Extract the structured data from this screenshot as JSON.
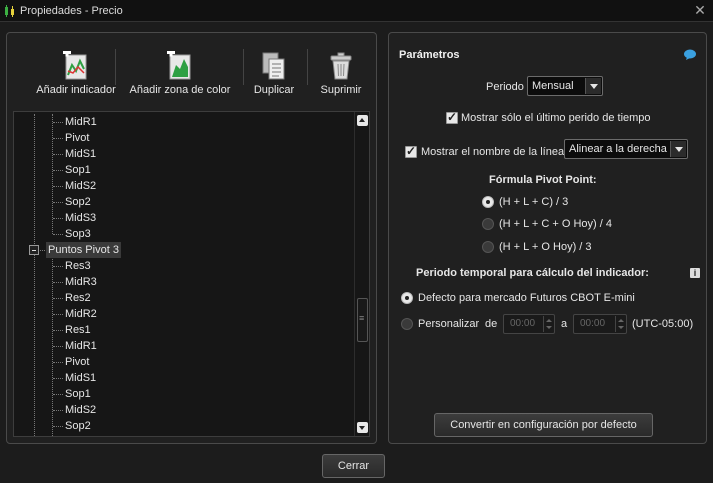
{
  "window": {
    "title": "Propiedades - Precio"
  },
  "toolbar": {
    "add_indicator": "Añadir indicador",
    "add_color_zone": "Añadir zona de color",
    "duplicate": "Duplicar",
    "delete": "Suprimir"
  },
  "tree": {
    "rows_before": [
      "MidR1",
      "Pivot",
      "MidS1",
      "Sop1",
      "MidS2",
      "Sop2",
      "MidS3",
      "Sop3"
    ],
    "group": "Puntos Pivot 3",
    "rows_after": [
      "Res3",
      "MidR3",
      "Res2",
      "MidR2",
      "Res1",
      "MidR1",
      "Pivot",
      "MidS1",
      "Sop1",
      "MidS2",
      "Sop2"
    ]
  },
  "params": {
    "title": "Parámetros",
    "period_label": "Periodo",
    "period_value": "Mensual",
    "show_last_label": "Mostrar sólo el último perido de tiempo",
    "show_name_label": "Mostrar el nombre de la línea",
    "align_value": "Alinear a la derecha",
    "formula_title": "Fórmula Pivot Point:",
    "formulas": [
      "(H + L + C) / 3",
      "(H + L + C + O Hoy) / 4",
      "(H + L + O Hoy) / 3"
    ],
    "period_calc_title": "Periodo temporal para cálculo del indicador:",
    "default_market": "Defecto para mercado Futuros CBOT E-mini",
    "customize": "Personalizar",
    "from": "de",
    "time_from": "00:00",
    "to": "a",
    "time_to": "00:00",
    "timezone": "(UTC-05:00)",
    "convert_button": "Convertir en configuración por defecto"
  },
  "footer": {
    "close_button": "Cerrar"
  }
}
